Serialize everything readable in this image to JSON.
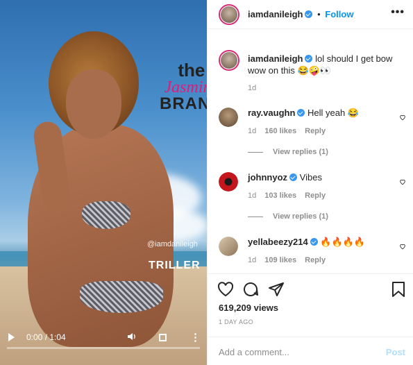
{
  "post": {
    "username": "iamdanileigh",
    "follow_label": "Follow",
    "header_bullet": "•",
    "more_label": "•••",
    "caption": "lol should I get bow wow on this 😂🤪👀",
    "caption_age": "1d"
  },
  "video": {
    "watermark_the": "the",
    "watermark_jasmine": "Jasmine",
    "watermark_brand": "BRAND",
    "handle_overlay": "@iamdanileigh",
    "app_logo": "TRILLER",
    "time": "0:00 / 1:04",
    "progress": 0.0
  },
  "comments": [
    {
      "username": "ray.vaughn",
      "text": "Hell yeah 😂",
      "age": "1d",
      "likes": "160 likes",
      "reply": "Reply",
      "view_replies": "View replies (1)",
      "avatar_color": "#8b6b4a"
    },
    {
      "username": "johnnyoz",
      "text": "Vibes",
      "age": "1d",
      "likes": "103 likes",
      "reply": "Reply",
      "view_replies": "View replies (1)",
      "avatar_color": "#c4161c"
    },
    {
      "username": "yellabeezy214",
      "text": "🔥🔥🔥🔥",
      "age": "1d",
      "likes": "109 likes",
      "reply": "Reply",
      "avatar_color": "#b8a48a"
    }
  ],
  "stats": {
    "views": "619,209 views",
    "time_ago": "1 DAY AGO"
  },
  "add_comment": {
    "placeholder": "Add a comment...",
    "post_label": "Post"
  },
  "colors": {
    "accent": "#0095f6",
    "verified": "#3897f0",
    "muted": "#8e8e8e",
    "story_ring": "#d62976"
  }
}
